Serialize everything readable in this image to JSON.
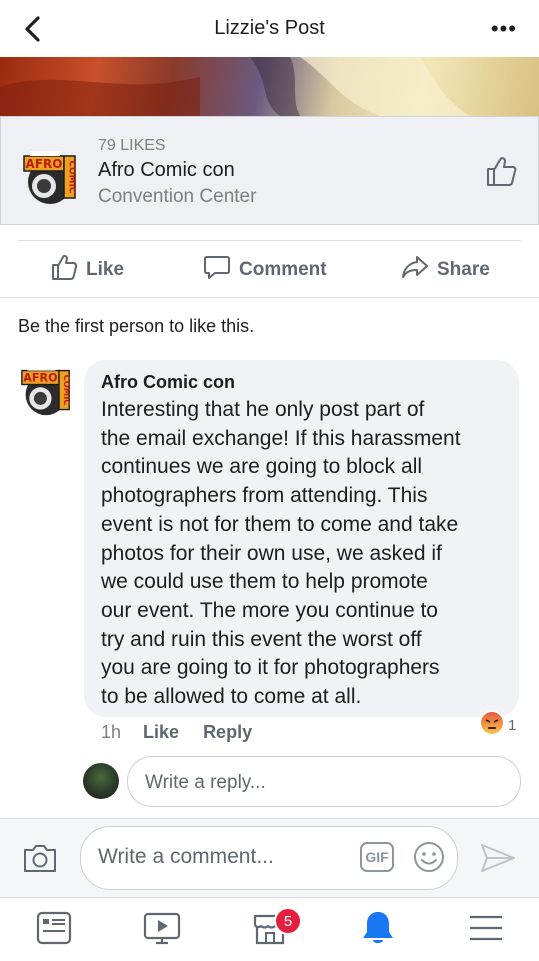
{
  "header": {
    "title": "Lizzie's Post",
    "more": "•••"
  },
  "page_card": {
    "likes": "79 LIKES",
    "name": "Afro Comic con",
    "category": "Convention Center",
    "logo_text": "AFRO COMIC"
  },
  "actions": {
    "like": "Like",
    "comment": "Comment",
    "share": "Share"
  },
  "first_like": "Be the first person to like this.",
  "comment": {
    "author": "Afro Comic con",
    "text": "Interesting that he only post part of\nthe email exchange! If this harassment\ncontinues we are going to block all\nphotographers from attending. This\nevent is not for them to come and take\nphotos for their own use, we asked if\nwe could use them to help promote\nour event. The more you continue to\ntry and ruin this event the worst off\nyou are going to it for photographers\nto be allowed to come at all.",
    "time": "1h",
    "like": "Like",
    "reply": "Reply",
    "reaction_count": "1",
    "reaction": "angry"
  },
  "reply_placeholder": "Write a reply...",
  "composer": {
    "placeholder": "Write a comment...",
    "gif": "GIF"
  },
  "nav": {
    "marketplace_badge": "5"
  },
  "colors": {
    "accent": "#1877f2",
    "badge": "#e41e3f",
    "icon_gray": "#606770"
  }
}
